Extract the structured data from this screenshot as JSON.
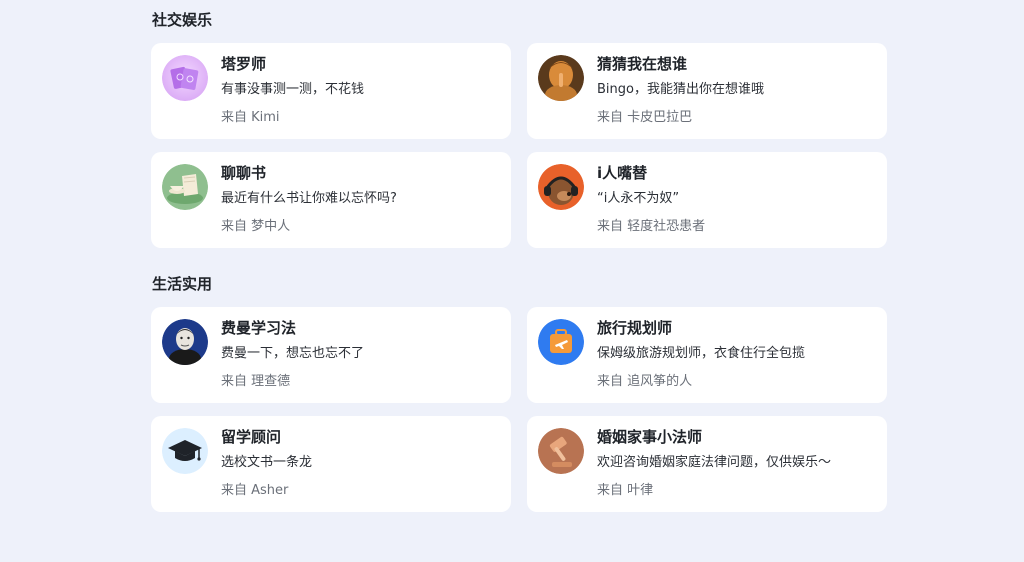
{
  "sections": [
    {
      "title": "社交娱乐",
      "cards": [
        {
          "name": "塔罗师",
          "desc": "有事没事测一测，不花钱",
          "author": "来自 Kimi",
          "icon": "tarot-cards-icon"
        },
        {
          "name": "猜猜我在想谁",
          "desc": "Bingo，我能猜出你在想谁哦",
          "author": "来自 卡皮巴拉巴",
          "icon": "thinking-person-icon"
        },
        {
          "name": "聊聊书",
          "desc": "最近有什么书让你难以忘怀吗?",
          "author": "来自 梦中人",
          "icon": "book-teacup-icon"
        },
        {
          "name": "i人嘴替",
          "desc": "“i人永不为奴”",
          "author": "来自 轻度社恐患者",
          "icon": "headphone-dog-icon"
        }
      ]
    },
    {
      "title": "生活实用",
      "cards": [
        {
          "name": "费曼学习法",
          "desc": "费曼一下，想忘也忘不了",
          "author": "来自 理查德",
          "icon": "feynman-portrait-icon"
        },
        {
          "name": "旅行规划师",
          "desc": "保姆级旅游规划师，衣食住行全包揽",
          "author": "来自 追风筝的人",
          "icon": "suitcase-airplane-icon"
        },
        {
          "name": "留学顾问",
          "desc": "选校文书一条龙",
          "author": "来自 Asher",
          "icon": "graduation-cap-icon"
        },
        {
          "name": "婚姻家事小法师",
          "desc": "欢迎咨询婚姻家庭法律问题，仅供娱乐～",
          "author": "来自 叶律",
          "icon": "gavel-icon"
        }
      ]
    }
  ]
}
